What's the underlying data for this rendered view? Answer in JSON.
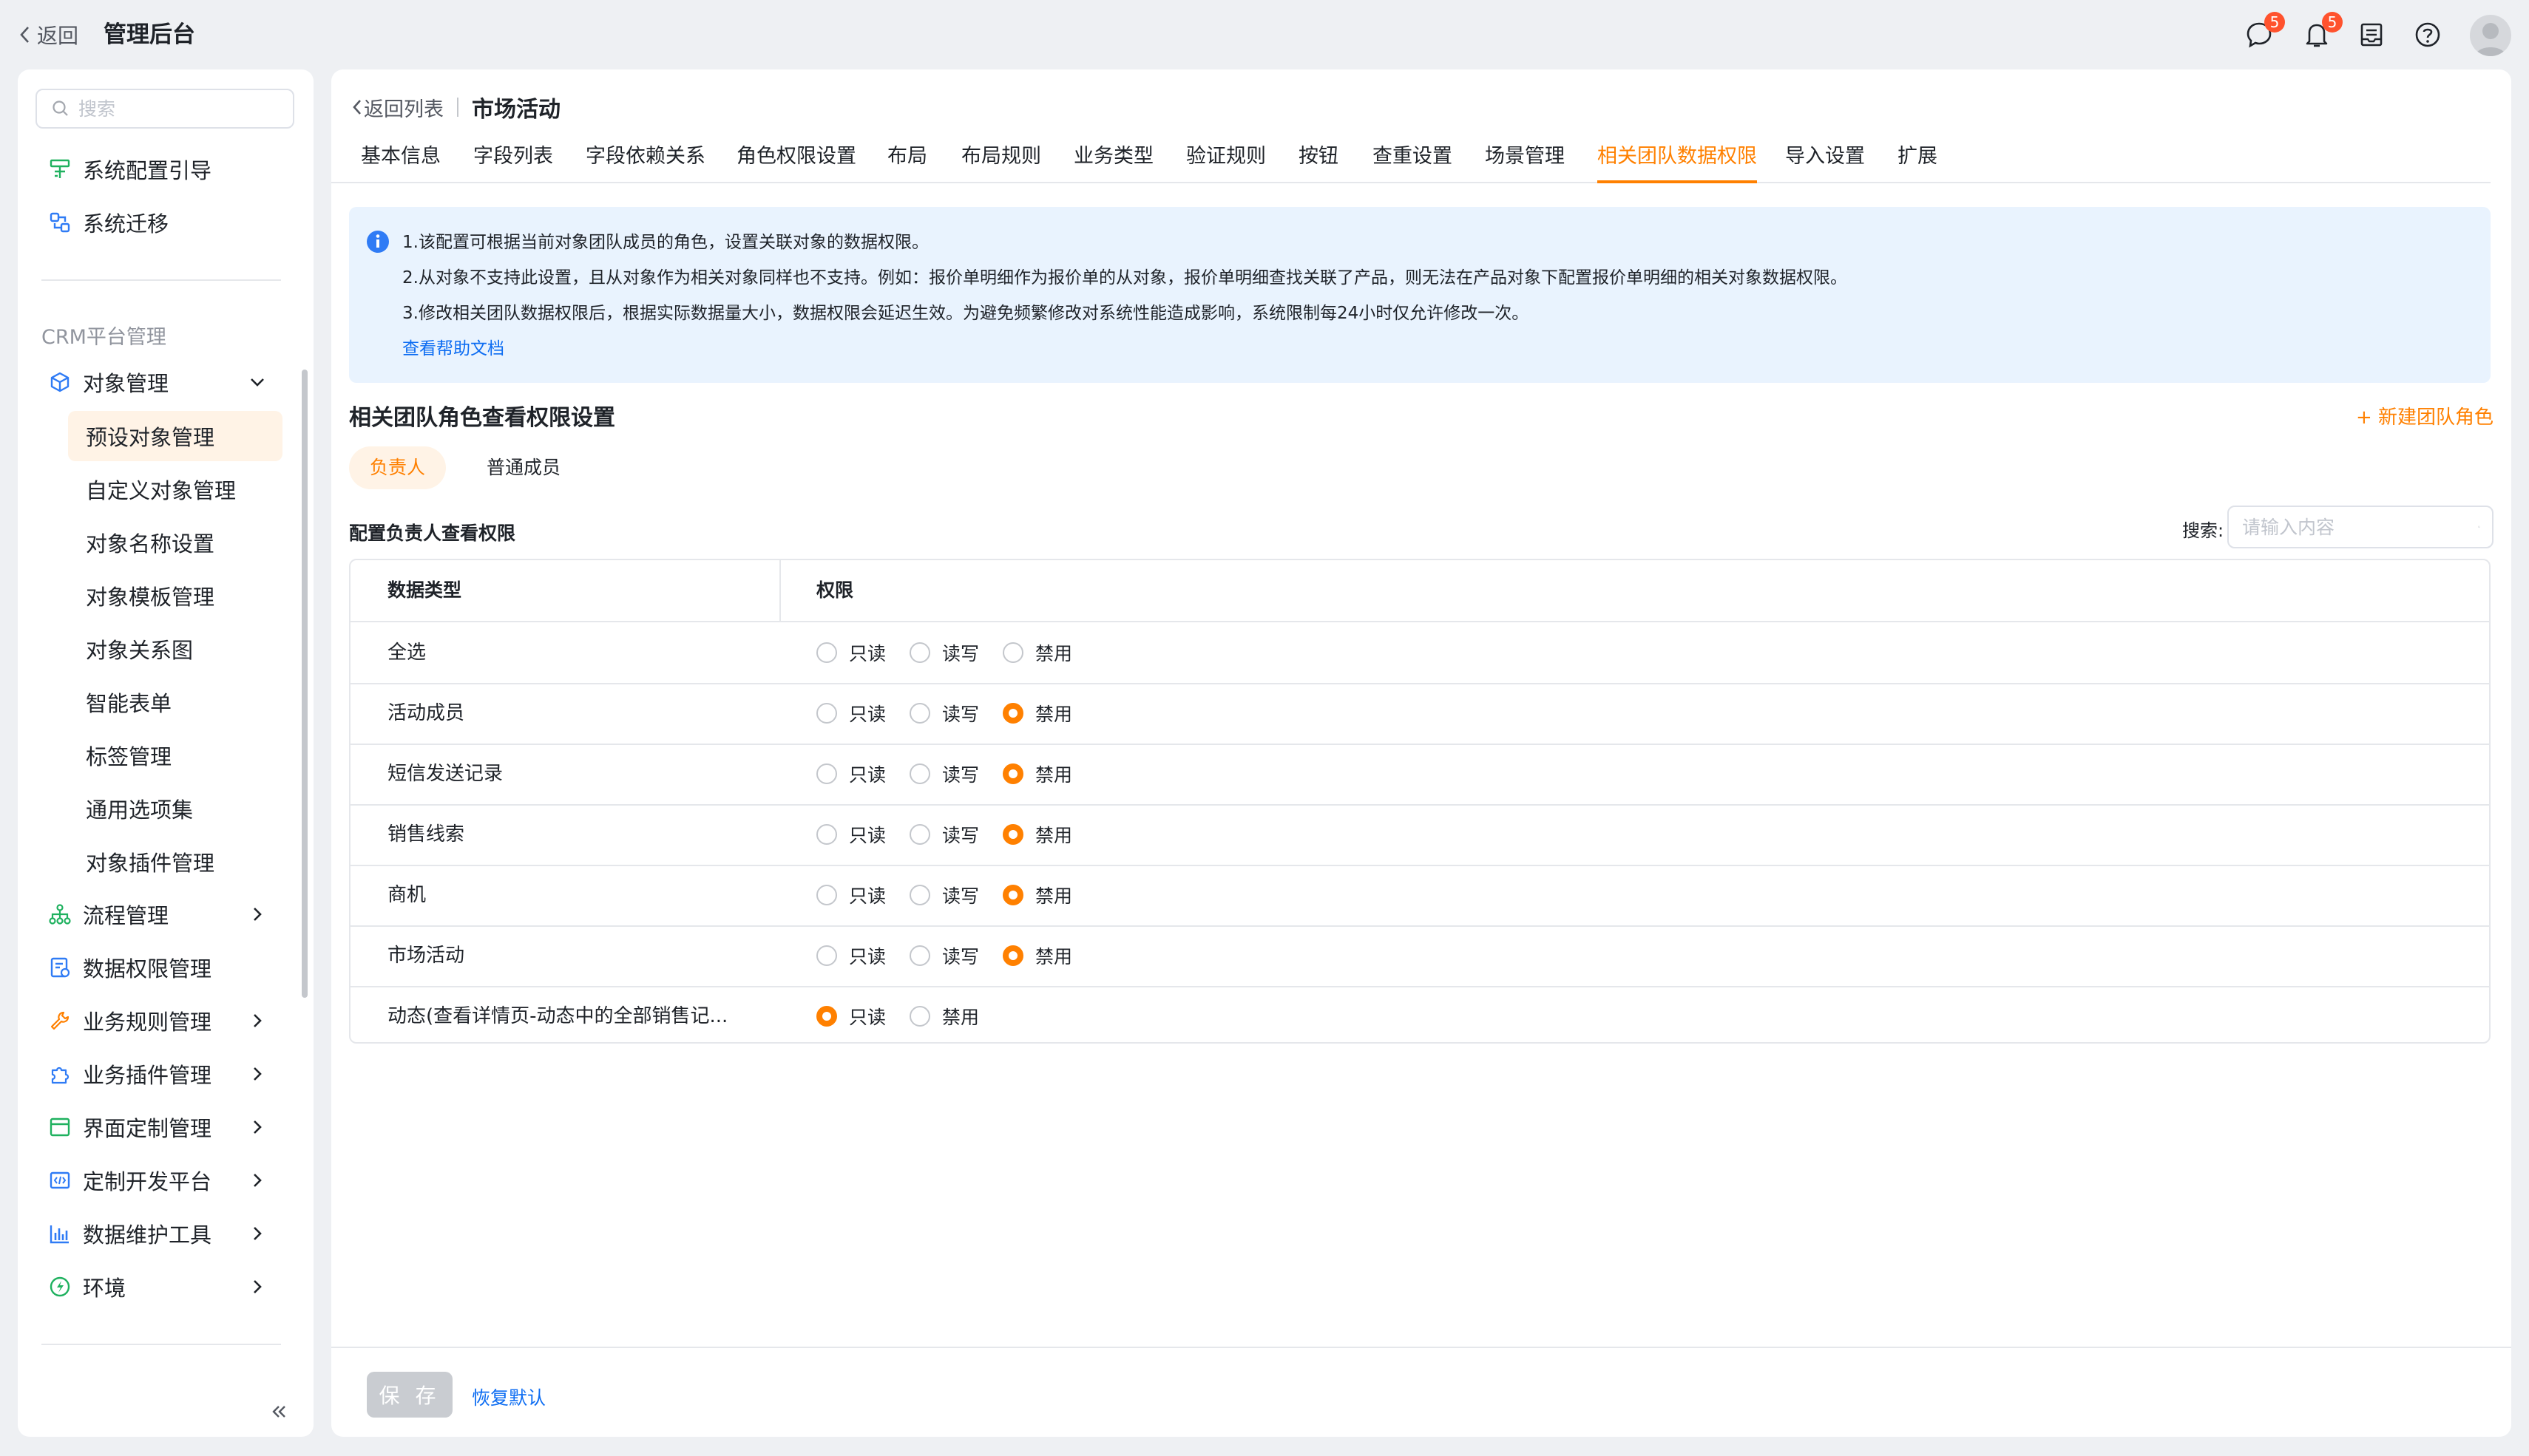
{
  "topbar": {
    "back_label": "返回",
    "title": "管理后台",
    "message_badge": "5",
    "bell_badge": "5"
  },
  "sidebar": {
    "search_placeholder": "搜索",
    "top_items": [
      {
        "label": "系统配置引导",
        "icon": "guide-icon"
      },
      {
        "label": "系统迁移",
        "icon": "migrate-icon"
      }
    ],
    "section_title": "CRM平台管理",
    "object_mgmt": {
      "label": "对象管理",
      "icon": "object-icon"
    },
    "sub_items": [
      "预设对象管理",
      "自定义对象管理",
      "对象名称设置",
      "对象模板管理",
      "对象关系图",
      "智能表单",
      "标签管理",
      "通用选项集",
      "对象插件管理"
    ],
    "active_sub": "预设对象管理",
    "bottom_items": [
      {
        "label": "流程管理",
        "icon": "flow-icon"
      },
      {
        "label": "数据权限管理",
        "icon": "data-permission-icon"
      },
      {
        "label": "业务规则管理",
        "icon": "wrench-icon"
      },
      {
        "label": "业务插件管理",
        "icon": "plugin-icon"
      },
      {
        "label": "界面定制管理",
        "icon": "layout-icon"
      },
      {
        "label": "定制开发平台",
        "icon": "code-icon"
      },
      {
        "label": "数据维护工具",
        "icon": "bar-chart-icon"
      },
      {
        "label": "环境",
        "icon": "environment-icon"
      }
    ]
  },
  "main": {
    "back_list": "返回列表",
    "page_title": "市场活动",
    "tabs": [
      "基本信息",
      "字段列表",
      "字段依赖关系",
      "角色权限设置",
      "布局",
      "布局规则",
      "业务类型",
      "验证规则",
      "按钮",
      "查重设置",
      "场景管理",
      "相关团队数据权限",
      "导入设置",
      "扩展"
    ],
    "active_tab": "相关团队数据权限",
    "notice": {
      "line1": "1.该配置可根据当前对象团队成员的角色，设置关联对象的数据权限。",
      "line2": "2.从对象不支持此设置，且从对象作为相关对象同样也不支持。例如：报价单明细作为报价单的从对象，报价单明细查找关联了产品，则无法在产品对象下配置报价单明细的相关对象数据权限。",
      "line3": "3.修改相关团队数据权限后，根据实际数据量大小，数据权限会延迟生效。为避免频繁修改对系统性能造成影响，系统限制每24小时仅允许修改一次。",
      "help_link": "查看帮助文档"
    },
    "section_title": "相关团队角色查看权限设置",
    "new_role": "+ 新建团队角色",
    "role_tabs": [
      "负责人",
      "普通成员"
    ],
    "config_label": "配置负责人查看权限",
    "search_label": "搜索:",
    "search_placeholder": "请输入内容",
    "table": {
      "headers": [
        "数据类型",
        "权限"
      ],
      "rows": [
        {
          "type": "全选",
          "options": [
            "只读",
            "读写",
            "禁用"
          ],
          "selected": ""
        },
        {
          "type": "活动成员",
          "options": [
            "只读",
            "读写",
            "禁用"
          ],
          "selected": "禁用"
        },
        {
          "type": "短信发送记录",
          "options": [
            "只读",
            "读写",
            "禁用"
          ],
          "selected": "禁用"
        },
        {
          "type": "销售线索",
          "options": [
            "只读",
            "读写",
            "禁用"
          ],
          "selected": "禁用"
        },
        {
          "type": "商机",
          "options": [
            "只读",
            "读写",
            "禁用"
          ],
          "selected": "禁用"
        },
        {
          "type": "市场活动",
          "options": [
            "只读",
            "读写",
            "禁用"
          ],
          "selected": "禁用"
        },
        {
          "type": "动态(查看详情页-动态中的全部销售记...",
          "options": [
            "只读",
            "禁用"
          ],
          "selected": "只读"
        }
      ]
    },
    "save_label": "保 存",
    "restore_label": "恢复默认"
  },
  "colors": {
    "accent": "#ff8000",
    "link": "#0c6cf2",
    "badge": "#ff522d",
    "notice_bg": "#e9f3fe"
  }
}
